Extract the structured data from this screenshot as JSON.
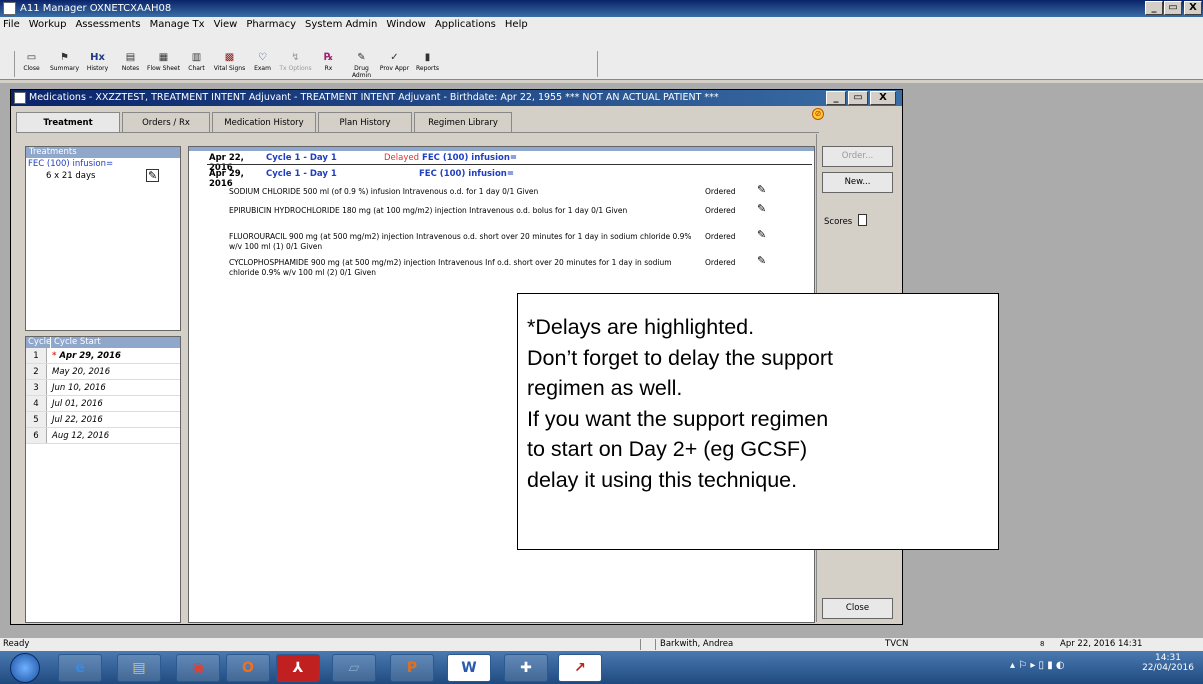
{
  "window": {
    "title": "A11 Manager OXNETCXAAH08",
    "min": "_",
    "max": "▭",
    "close": "X"
  },
  "menu": [
    "File",
    "Workup",
    "Assessments",
    "Manage Tx",
    "View",
    "Pharmacy",
    "System Admin",
    "Window",
    "Applications",
    "Help"
  ],
  "toolbar": [
    {
      "label": "Close",
      "icon": "folder-icon"
    },
    {
      "label": "Summary",
      "icon": "flag-icon"
    },
    {
      "label": "History",
      "icon": "hx-icon"
    },
    {
      "label": "Notes",
      "icon": "notes-icon"
    },
    {
      "label": "Flow Sheet",
      "icon": "grid-icon"
    },
    {
      "label": "Chart",
      "icon": "chart-icon"
    },
    {
      "label": "Vital Signs",
      "icon": "vitals-icon"
    },
    {
      "label": "Exam",
      "icon": "stethoscope-icon"
    },
    {
      "label": "Tx Options",
      "icon": "tx-options-icon"
    },
    {
      "label": "Rx",
      "icon": "rx-icon"
    },
    {
      "label": "Drug Admin",
      "icon": "drug-admin-icon"
    },
    {
      "label": "Prov Appr",
      "icon": "approve-icon"
    },
    {
      "label": "Reports",
      "icon": "reports-icon"
    }
  ],
  "med_window": {
    "title": "Medications - XXZZTEST, TREATMENT INTENT Adjuvant - TREATMENT INTENT Adjuvant - Birthdate: Apr 22, 1955 *** NOT AN ACTUAL PATIENT ***",
    "tabs": [
      "Treatment",
      "Orders / Rx",
      "Medication History",
      "Plan History",
      "Regimen Library"
    ],
    "treatments_header": "Treatments",
    "treatment_name": "FEC (100) infusion=",
    "treatment_schedule": "6 x 21 days",
    "cycle_headers": [
      "Cycle",
      "Cycle Start"
    ],
    "cycles": [
      {
        "num": "1",
        "date": "Apr 29, 2016",
        "delayed": true
      },
      {
        "num": "2",
        "date": "May 20, 2016"
      },
      {
        "num": "3",
        "date": "Jun 10, 2016"
      },
      {
        "num": "4",
        "date": "Jul 01, 2016"
      },
      {
        "num": "5",
        "date": "Jul 22, 2016"
      },
      {
        "num": "6",
        "date": "Aug 12, 2016"
      }
    ],
    "rows": [
      {
        "date": "Apr 22, 2016",
        "cycle": "Cycle 1 - Day 1",
        "status": "Delayed",
        "regimen": "FEC (100) infusion="
      },
      {
        "date": "Apr 29, 2016",
        "cycle": "Cycle 1 - Day 1",
        "status": "",
        "regimen": "FEC (100) infusion="
      }
    ],
    "meds": [
      {
        "text": "SODIUM CHLORIDE 500 ml (of 0.9 %) infusion Intravenous o.d. for 1 day   0/1 Given",
        "status": "Ordered"
      },
      {
        "text": "EPIRUBICIN HYDROCHLORIDE 180 mg (at 100 mg/m2) injection Intravenous o.d. bolus for 1 day   0/1 Given",
        "status": "Ordered"
      },
      {
        "text": "FLUOROURACIL 900 mg (at 500 mg/m2) injection Intravenous o.d. short over 20 minutes for 1 day in sodium chloride 0.9% w/v 100 ml (1)   0/1 Given",
        "status": "Ordered"
      },
      {
        "text": "CYCLOPHOSPHAMIDE 900 mg (at 500 mg/m2) injection Intravenous Inf o.d. short over 20 minutes for 1 day in sodium chloride 0.9% w/v 100 ml (2)   0/1 Given",
        "status": "Ordered"
      }
    ],
    "buttons": {
      "order": "Order...",
      "new": "New...",
      "scores": "Scores",
      "close": "Close"
    }
  },
  "callout": [
    "*Delays are highlighted.",
    "Don’t forget to delay the support",
    "regimen as well.",
    "If you want the support regimen",
    "to start on Day 2+ (eg GCSF)",
    "delay it using this technique."
  ],
  "statusbar": {
    "left": "Ready",
    "user": "Barkwith, Andrea",
    "site": "TVCN",
    "marker": "8",
    "datetime": "Apr 22, 2016 14:31"
  },
  "taskbar": {
    "time": "14:31",
    "date": "22/04/2016",
    "apps": [
      "ie-icon",
      "explorer-icon",
      "chrome-icon",
      "outlook-icon",
      "acrobat-icon",
      "notes-icon",
      "powerpoint-icon",
      "word-icon",
      "medical-icon",
      "chart-app-icon"
    ]
  },
  "colors": {
    "delayed": "#e03030",
    "cycle_blue": "#1f3fc0",
    "header_blue": "#8ea7cb"
  }
}
